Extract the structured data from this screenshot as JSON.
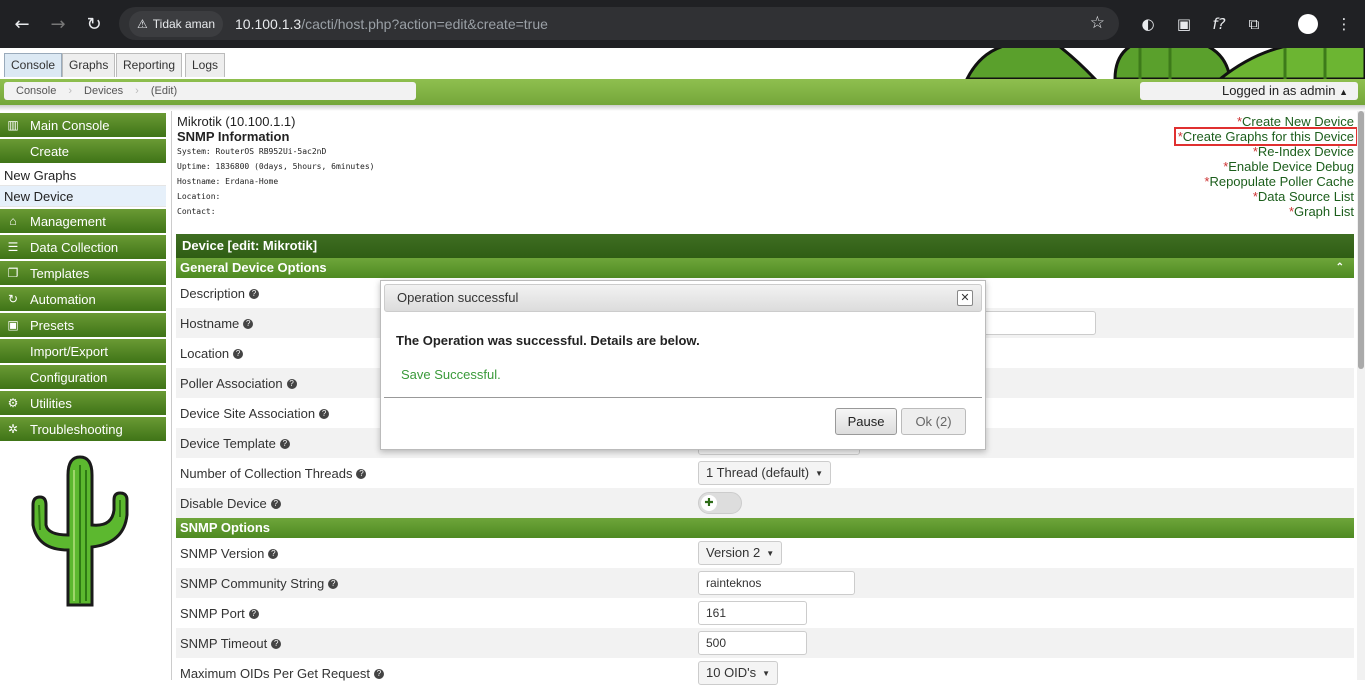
{
  "browser": {
    "security_label": "Tidak aman",
    "url_host": "10.100.1.3",
    "url_path": "/cacti/host.php?action=edit&create=true"
  },
  "tabs": [
    "Console",
    "Graphs",
    "Reporting",
    "Logs"
  ],
  "breadcrumb": [
    "Console",
    "Devices",
    "(Edit)"
  ],
  "login_text": "Logged in as admin",
  "sidebar": {
    "main_console": "Main Console",
    "create": "Create",
    "new_graphs": "New Graphs",
    "new_device": "New Device",
    "management": "Management",
    "data_collection": "Data Collection",
    "templates": "Templates",
    "automation": "Automation",
    "presets": "Presets",
    "import_export": "Import/Export",
    "configuration": "Configuration",
    "utilities": "Utilities",
    "troubleshooting": "Troubleshooting"
  },
  "device_info": {
    "host": "Mikrotik (10.100.1.1)",
    "snmp_title": "SNMP Information",
    "system": "System: RouterOS RB952Ui-5ac2nD",
    "uptime": "Uptime: 1836800 (0days, 5hours, 6minutes)",
    "hostname": "Hostname: Erdana-Home",
    "location": "Location:",
    "contact": "Contact:"
  },
  "actions": {
    "create_new_device": "Create New Device",
    "create_graphs": "Create Graphs for this Device",
    "reindex": "Re-Index Device",
    "enable_debug": "Enable Device Debug",
    "repopulate": "Repopulate Poller Cache",
    "data_source_list": "Data Source List",
    "graph_list": "Graph List"
  },
  "form": {
    "header": "Device [edit: Mikrotik]",
    "general_section": "General Device Options",
    "fields": {
      "description": "Description",
      "hostname": "Hostname",
      "location": "Location",
      "poller": "Poller Association",
      "site": "Device Site Association",
      "template": "Device Template",
      "threads": "Number of Collection Threads",
      "disable": "Disable Device"
    },
    "threads_value": "1 Thread (default)",
    "snmp_section": "SNMP Options",
    "snmp_fields": {
      "version": "SNMP Version",
      "community": "SNMP Community String",
      "port": "SNMP Port",
      "timeout": "SNMP Timeout",
      "max_oids": "Maximum OIDs Per Get Request"
    },
    "snmp_version_value": "Version 2",
    "community_value": "rainteknos",
    "port_value": "161",
    "timeout_value": "500",
    "max_oids_value": "10 OID's"
  },
  "dialog": {
    "title": "Operation successful",
    "message": "The Operation was successful. Details are below.",
    "detail": "Save Successful.",
    "pause_label": "Pause",
    "ok_label": "Ok (2)"
  }
}
